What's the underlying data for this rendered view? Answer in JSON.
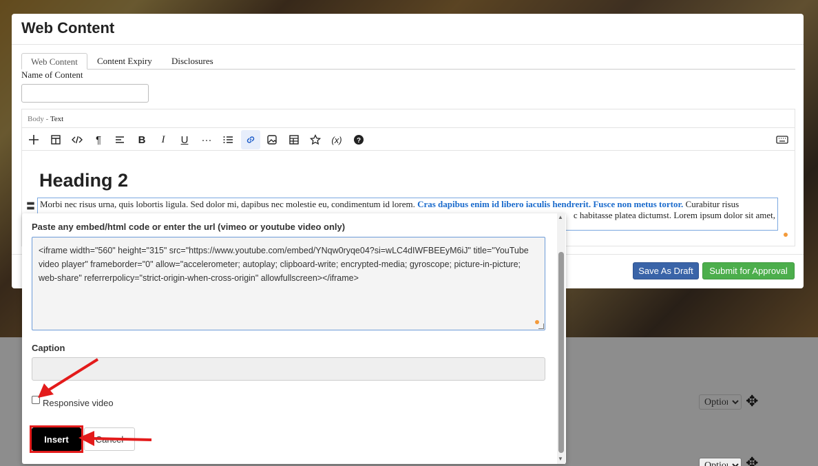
{
  "modal": {
    "title": "Web Content",
    "tabs": [
      {
        "label": "Web Content"
      },
      {
        "label": "Content Expiry"
      },
      {
        "label": "Disclosures"
      }
    ],
    "name_label": "Name of Content",
    "name_value": "",
    "body_label": "Body -",
    "body_mode": "Text",
    "heading": "Heading 2",
    "paragraph_start": "Morbi nec risus urna, quis lobortis ligula. Sed dolor mi, dapibus nec molestie eu, condimentum id lorem. ",
    "paragraph_highlight": "Cras dapibus enim id libero iaculis hendrerit. Fusce non metus tortor.",
    "paragraph_end": " Curabitur risus",
    "paragraph_line2": "c habitasse platea dictumst. Lorem ipsum dolor sit amet,",
    "save_draft_label": "Save As Draft",
    "submit_label": "Submit for Approval"
  },
  "toolbar": {
    "icons": [
      "plus-icon",
      "template-icon",
      "code-icon",
      "paragraph-icon",
      "align-icon",
      "bold-icon",
      "italic-icon",
      "underline-icon",
      "more-icon",
      "list-icon",
      "link-icon",
      "image-icon",
      "table-icon",
      "star-icon",
      "variable-icon",
      "help-icon",
      "keyboard-icon"
    ],
    "active": "link-icon"
  },
  "embed_dialog": {
    "label": "Paste any embed/html code or enter the url (vimeo or youtube video only)",
    "code": "<iframe width=\"560\" height=\"315\" src=\"https://www.youtube.com/embed/YNqw0ryqe04?si=wLC4dIWFBEEyM6iJ\" title=\"YouTube video player\" frameborder=\"0\" allow=\"accelerometer; autoplay; clipboard-write; encrypted-media; gyroscope; picture-in-picture; web-share\" referrerpolicy=\"strict-origin-when-cross-origin\" allowfullscreen></iframe>",
    "caption_label": "Caption",
    "caption_value": "",
    "responsive_label": "Responsive video",
    "responsive_checked": false,
    "insert_label": "Insert",
    "cancel_label": "Cancel"
  },
  "background": {
    "options_label": "Options"
  },
  "colors": {
    "annotation": "#e31b1b",
    "save_draft": "#3a64a8",
    "submit": "#4cae4c",
    "link_highlight": "#1b6bcc"
  }
}
